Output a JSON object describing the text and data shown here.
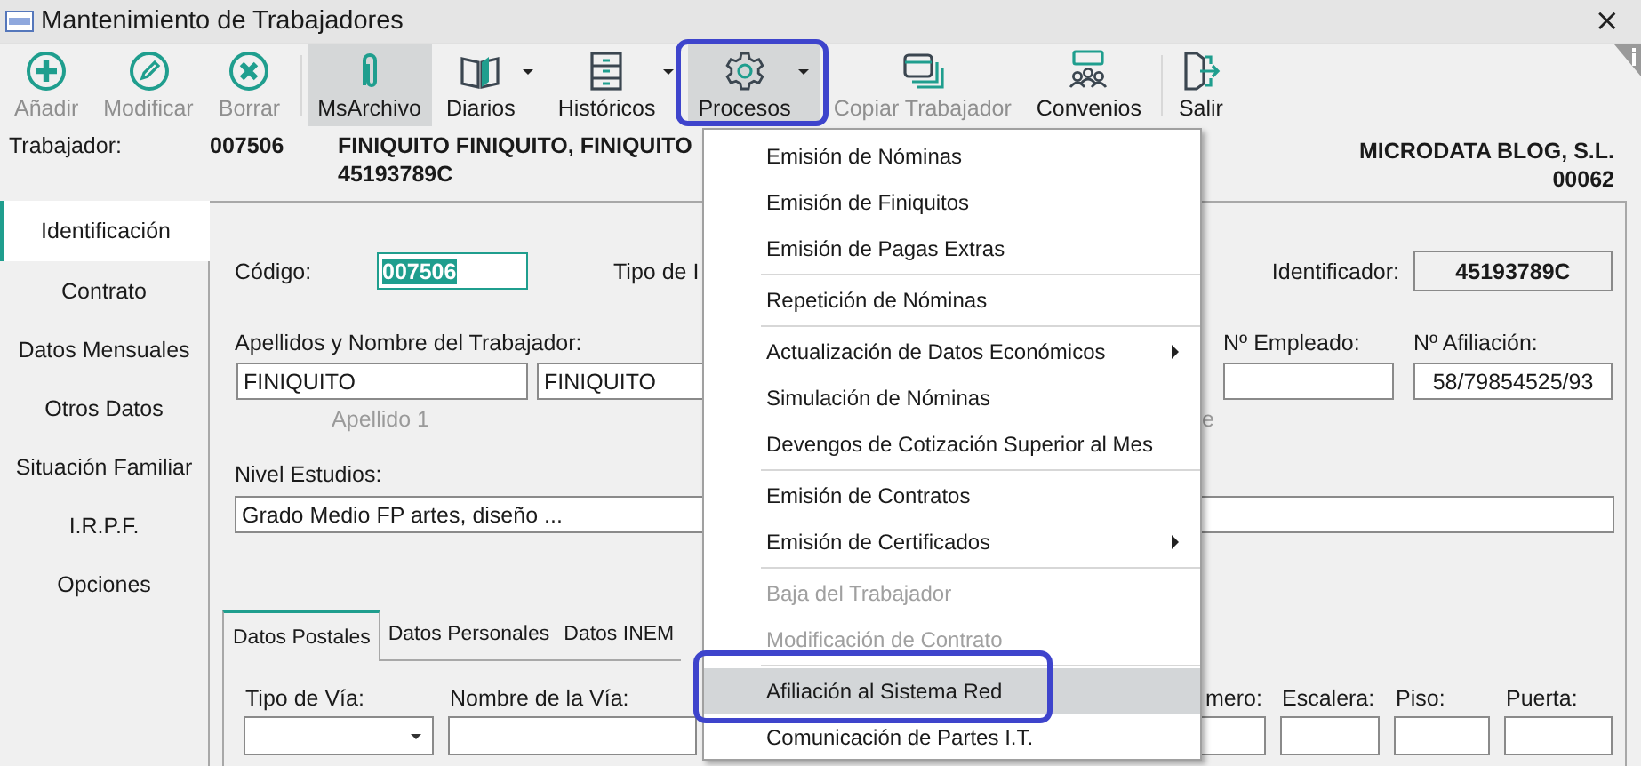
{
  "window": {
    "title": "Mantenimiento de Trabajadores",
    "close": "×"
  },
  "toolbar": [
    {
      "label": "Añadir",
      "disabled": true,
      "selected": false,
      "dropdown": false,
      "highlighted": false
    },
    {
      "label": "Modificar",
      "disabled": true,
      "selected": false,
      "dropdown": false,
      "highlighted": false
    },
    {
      "label": "Borrar",
      "disabled": true,
      "selected": false,
      "dropdown": false,
      "highlighted": false
    },
    {
      "label": "MsArchivo",
      "disabled": false,
      "selected": true,
      "dropdown": false,
      "highlighted": false
    },
    {
      "label": "Diarios",
      "disabled": false,
      "selected": false,
      "dropdown": true,
      "highlighted": false
    },
    {
      "label": "Históricos",
      "disabled": false,
      "selected": false,
      "dropdown": true,
      "highlighted": false
    },
    {
      "label": "Procesos",
      "disabled": false,
      "selected": true,
      "dropdown": true,
      "highlighted": true
    },
    {
      "label": "Copiar Trabajador",
      "disabled": true,
      "selected": false,
      "dropdown": false,
      "highlighted": false
    },
    {
      "label": "Convenios",
      "disabled": false,
      "selected": false,
      "dropdown": false,
      "highlighted": false
    },
    {
      "label": "Salir",
      "disabled": false,
      "selected": false,
      "dropdown": false,
      "highlighted": false
    }
  ],
  "header": {
    "label": "Trabajador:",
    "code": "007506",
    "name": "FINIQUITO FINIQUITO, FINIQUITO",
    "id": "45193789C",
    "company": "MICRODATA BLOG, S.L.",
    "company_code": "00062"
  },
  "side_tabs": [
    {
      "label": "Identificación",
      "selected": true
    },
    {
      "label": "Contrato",
      "selected": false
    },
    {
      "label": "Datos Mensuales",
      "selected": false
    },
    {
      "label": "Otros Datos",
      "selected": false
    },
    {
      "label": "Situación Familiar",
      "selected": false
    },
    {
      "label": "I.R.P.F.",
      "selected": false
    },
    {
      "label": "Opciones",
      "selected": false
    }
  ],
  "form": {
    "codigo_label": "Código:",
    "codigo_value": "007506",
    "tipo_label": "Tipo de I",
    "identificador_label": "Identificador:",
    "identificador_value": "45193789C",
    "apellidos_label": "Apellidos y Nombre del Trabajador:",
    "apellido1_value": "FINIQUITO",
    "apellido2_value": "FINIQUITO",
    "apellido1_caption": "Apellido 1",
    "apellido2_caption": "e",
    "empleado_label": "Nº Empleado:",
    "afiliacion_label": "Nº Afiliación:",
    "afiliacion_value": "58/79854525/93",
    "nivel_label": "Nivel Estudios:",
    "nivel_value": "Grado Medio FP artes, diseño ..."
  },
  "inner_tabs": [
    {
      "label": "Datos Postales",
      "selected": true
    },
    {
      "label": "Datos Personales",
      "selected": false
    },
    {
      "label": "Datos INEM",
      "selected": false
    }
  ],
  "postal_fields": [
    {
      "label": "Tipo de Vía:",
      "kind": "dropdown"
    },
    {
      "label": "Nombre de la Vía:",
      "kind": "text"
    },
    {
      "label": "mero:",
      "kind": "text"
    },
    {
      "label": "Escalera:",
      "kind": "text"
    },
    {
      "label": "Piso:",
      "kind": "text"
    },
    {
      "label": "Puerta:",
      "kind": "text"
    }
  ],
  "menu": {
    "items": [
      {
        "kind": "item",
        "label": "Emisión de Nóminas",
        "disabled": false,
        "selected": false,
        "submenu": false,
        "highlighted": false
      },
      {
        "kind": "item",
        "label": "Emisión de Finiquitos",
        "disabled": false,
        "selected": false,
        "submenu": false,
        "highlighted": false
      },
      {
        "kind": "item",
        "label": "Emisión de Pagas Extras",
        "disabled": false,
        "selected": false,
        "submenu": false,
        "highlighted": false
      },
      {
        "kind": "separator"
      },
      {
        "kind": "item",
        "label": "Repetición de Nóminas",
        "disabled": false,
        "selected": false,
        "submenu": false,
        "highlighted": false
      },
      {
        "kind": "separator"
      },
      {
        "kind": "item",
        "label": "Actualización de Datos Económicos",
        "disabled": false,
        "selected": false,
        "submenu": true,
        "highlighted": false
      },
      {
        "kind": "item",
        "label": "Simulación de Nóminas",
        "disabled": false,
        "selected": false,
        "submenu": false,
        "highlighted": false
      },
      {
        "kind": "item",
        "label": "Devengos de Cotización Superior al Mes",
        "disabled": false,
        "selected": false,
        "submenu": false,
        "highlighted": false
      },
      {
        "kind": "separator"
      },
      {
        "kind": "item",
        "label": "Emisión de Contratos",
        "disabled": false,
        "selected": false,
        "submenu": false,
        "highlighted": false
      },
      {
        "kind": "item",
        "label": "Emisión de Certificados",
        "disabled": false,
        "selected": false,
        "submenu": true,
        "highlighted": false
      },
      {
        "kind": "separator"
      },
      {
        "kind": "item",
        "label": "Baja del Trabajador",
        "disabled": true,
        "selected": false,
        "submenu": false,
        "highlighted": false
      },
      {
        "kind": "item",
        "label": "Modificación de Contrato",
        "disabled": true,
        "selected": false,
        "submenu": false,
        "highlighted": false
      },
      {
        "kind": "separator"
      },
      {
        "kind": "item",
        "label": "Afiliación al Sistema Red",
        "disabled": false,
        "selected": true,
        "submenu": false,
        "highlighted": true
      },
      {
        "kind": "item",
        "label": "Comunicación de Partes I.T.",
        "disabled": false,
        "selected": false,
        "submenu": false,
        "highlighted": false
      }
    ]
  }
}
